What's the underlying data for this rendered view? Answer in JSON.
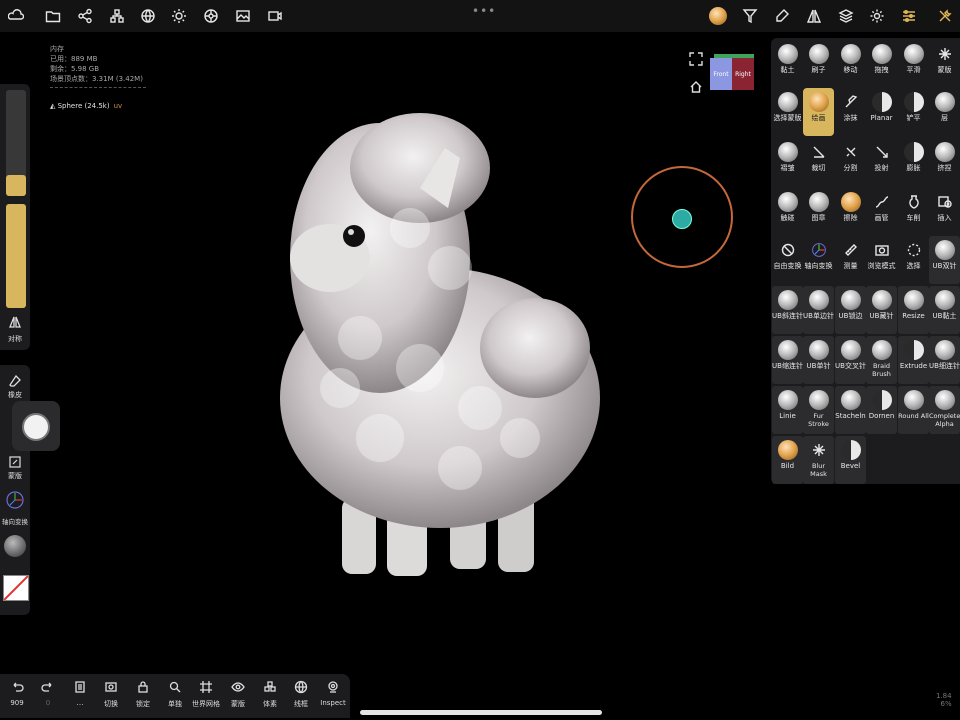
{
  "top_toolbar": {
    "left_icons": [
      "cloud-icon",
      "folder-icon",
      "share-nodes-icon",
      "scene-icon",
      "globe-icon",
      "sun-icon",
      "material-icon",
      "image-icon",
      "video-icon"
    ],
    "center_dots": "•••",
    "right_icons": [
      "brush-preview-icon",
      "filter-icon",
      "paint-icon",
      "symmetry-icon",
      "layers-icon",
      "gear-icon",
      "sliders-icon",
      "tools-icon"
    ]
  },
  "viewport": {
    "memory": {
      "heading": "内存",
      "used": "已用：889 MB",
      "free": "剩余：5.98 GB",
      "vertices": "场景顶点数：3.31M (3.42M)"
    },
    "scene_object": {
      "name": "Sphere (24.5k)",
      "tag": "uv"
    },
    "view_cube": {
      "front": "Front",
      "right": "Right"
    },
    "fps": {
      "line1": "1.84",
      "line2": "6%"
    }
  },
  "left_panel": {
    "symmetry_label": "对称",
    "eraser_label": "橡皮",
    "mask_label": "蒙版",
    "gizmo_label": "轴向变换",
    "size_slider": 0.2,
    "intensity_slider": 1.0
  },
  "bottom_toolbar": [
    {
      "label": "909",
      "icon": "undo-icon",
      "name": "undo-button"
    },
    {
      "label": "0",
      "icon": "redo-icon",
      "name": "redo-button"
    },
    {
      "label": "…",
      "icon": "document-icon",
      "name": "more-button"
    },
    {
      "label": "切换",
      "icon": "switch-icon",
      "name": "switch-button"
    },
    {
      "label": "锁定",
      "icon": "lock-icon",
      "name": "lock-button"
    },
    {
      "label": "单独",
      "icon": "isolate-icon",
      "name": "isolate-button"
    },
    {
      "label": "世界网格",
      "icon": "grid-icon",
      "name": "world-grid-button"
    },
    {
      "label": "蒙版",
      "icon": "eye-icon",
      "name": "mask-view-button"
    },
    {
      "label": "体素",
      "icon": "voxel-icon",
      "name": "voxel-button"
    },
    {
      "label": "线框",
      "icon": "wireframe-icon",
      "name": "wireframe-button"
    },
    {
      "label": "Inspect",
      "icon": "inspect-icon",
      "name": "inspect-button"
    }
  ],
  "tool_panel": {
    "rows": [
      [
        {
          "label": "黏土"
        },
        {
          "label": "刷子"
        },
        {
          "label": "移动"
        },
        {
          "label": "拖拽"
        },
        {
          "label": "平滑"
        },
        {
          "label": "蒙版"
        }
      ],
      [
        {
          "label": "选择蒙版"
        },
        {
          "label": "绘画",
          "selected": true
        },
        {
          "label": "涂抹"
        },
        {
          "label": "Planar"
        },
        {
          "label": "铲平"
        },
        {
          "label": "层"
        }
      ],
      [
        {
          "label": "褶皱"
        },
        {
          "label": "裁切"
        },
        {
          "label": "分割"
        },
        {
          "label": "投射"
        },
        {
          "label": "膨胀"
        },
        {
          "label": "挤捏"
        }
      ],
      [
        {
          "label": "触碰"
        },
        {
          "label": "图章"
        },
        {
          "label": "擦除"
        },
        {
          "label": "画管"
        },
        {
          "label": "车削"
        },
        {
          "label": "插入"
        }
      ],
      [
        {
          "label": "自由变换"
        },
        {
          "label": "轴向变换"
        },
        {
          "label": "测量"
        },
        {
          "label": "浏览模式"
        },
        {
          "label": "选择"
        },
        {
          "label": "UB双针"
        }
      ],
      [
        {
          "label": "UB斜连针"
        },
        {
          "label": "UB单边针"
        },
        {
          "label": "UB锁边"
        },
        {
          "label": "UB藏针"
        },
        {
          "label": "Resize"
        },
        {
          "label": "UB黏土"
        }
      ],
      [
        {
          "label": "UB缩连针"
        },
        {
          "label": "UB单针"
        },
        {
          "label": "UB交叉针"
        },
        {
          "label": "Braid Brush"
        },
        {
          "label": "Extrude"
        },
        {
          "label": "UB细连针"
        }
      ],
      [
        {
          "label": "Linie"
        },
        {
          "label": "Fur Stroke"
        },
        {
          "label": "Stacheln"
        },
        {
          "label": "Dornen"
        },
        {
          "label": "Round All"
        },
        {
          "label": "Complete Alpha"
        }
      ],
      [
        {
          "label": "Bild"
        },
        {
          "label": "Blur Mask"
        },
        {
          "label": "Bevel"
        }
      ]
    ]
  }
}
